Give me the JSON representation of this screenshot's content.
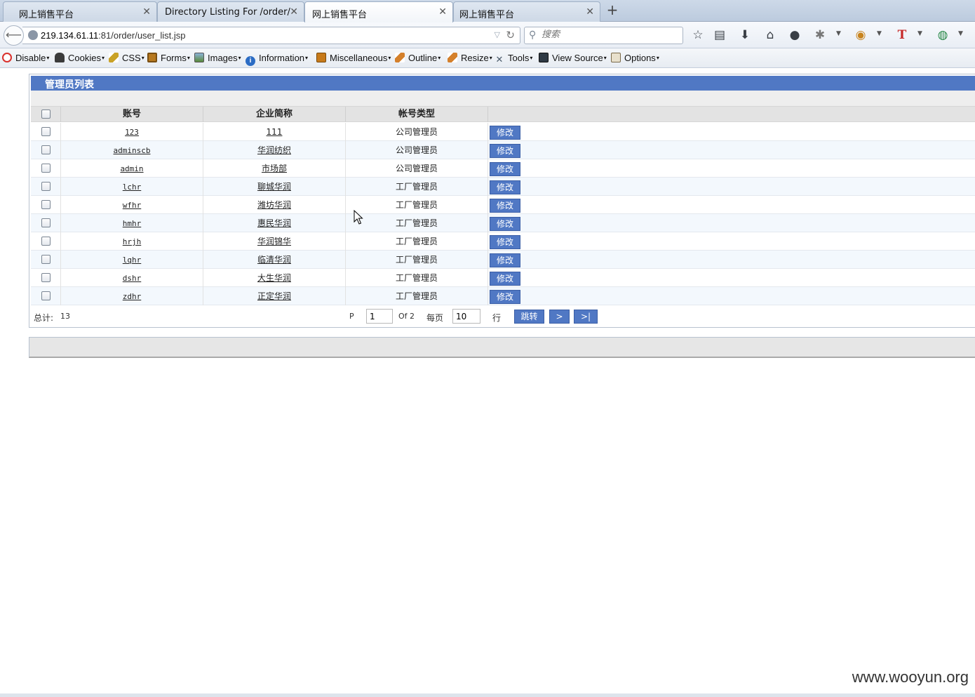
{
  "browser": {
    "tabs": [
      {
        "title": "网上销售平台",
        "active": false
      },
      {
        "title": "Directory Listing For /order/",
        "active": false
      },
      {
        "title": "网上销售平台",
        "active": true
      },
      {
        "title": "网上销售平台",
        "active": false
      }
    ],
    "url_host": "219.134.61.11",
    "url_rest": ":81/order/user_list.jsp",
    "search_placeholder": "搜索"
  },
  "devbar": {
    "items": [
      {
        "label": "Disable",
        "icon": "no-entry-icon",
        "color": "#d9302c"
      },
      {
        "label": "Cookies",
        "icon": "person-icon",
        "color": "#3b3b3b"
      },
      {
        "label": "CSS",
        "icon": "pencil-icon",
        "color": "#c9a227"
      },
      {
        "label": "Forms",
        "icon": "clipboard-icon",
        "color": "#b7791f"
      },
      {
        "label": "Images",
        "icon": "image-icon",
        "color": "#5a8a3a"
      },
      {
        "label": "Information",
        "icon": "info-icon",
        "color": "#2b6cc4"
      },
      {
        "label": "Miscellaneous",
        "icon": "book-icon",
        "color": "#c77a1a"
      },
      {
        "label": "Outline",
        "icon": "pencil-icon",
        "color": "#d4802b"
      },
      {
        "label": "Resize",
        "icon": "ruler-icon",
        "color": "#d4802b"
      },
      {
        "label": "Tools",
        "icon": "tools-icon",
        "color": "#4a5a6a"
      },
      {
        "label": "View Source",
        "icon": "terminal-icon",
        "color": "#2f3a44"
      },
      {
        "label": "Options",
        "icon": "options-icon",
        "color": "#7a6a4a"
      }
    ]
  },
  "page": {
    "panel_title": "管理员列表",
    "headers": {
      "account": "账号",
      "company": "企业简称",
      "type": "帐号类型"
    },
    "edit_label": "修改",
    "rows": [
      {
        "account": "123",
        "company": "111",
        "type": "公司管理员"
      },
      {
        "account": "adminscb",
        "company": "华润纺织",
        "type": "公司管理员"
      },
      {
        "account": "admin",
        "company": "市场部",
        "type": "公司管理员"
      },
      {
        "account": "lchr",
        "company": "聊城华润",
        "type": "工厂管理员"
      },
      {
        "account": "wfhr",
        "company": "潍坊华润",
        "type": "工厂管理员"
      },
      {
        "account": "hmhr",
        "company": "惠民华润",
        "type": "工厂管理员"
      },
      {
        "account": "hrjh",
        "company": "华润锦华",
        "type": "工厂管理员"
      },
      {
        "account": "lqhr",
        "company": "临清华润",
        "type": "工厂管理员"
      },
      {
        "account": "dshr",
        "company": "大生华润",
        "type": "工厂管理员"
      },
      {
        "account": "zdhr",
        "company": "正定华润",
        "type": "工厂管理员"
      }
    ],
    "pager": {
      "total_label": "总计:",
      "total": "13",
      "p_label": "P",
      "page": "1",
      "of_label": "Of 2",
      "per_page_label": "每页",
      "per_page": "10",
      "rows_label": "行",
      "jump_label": "跳转",
      "next_label": ">",
      "last_label": ">|"
    }
  },
  "watermark": "www.wooyun.org",
  "colors": {
    "accent": "#5078c4",
    "row_alt": "#f3f8fd",
    "header_bg": "#e3e3e3"
  }
}
